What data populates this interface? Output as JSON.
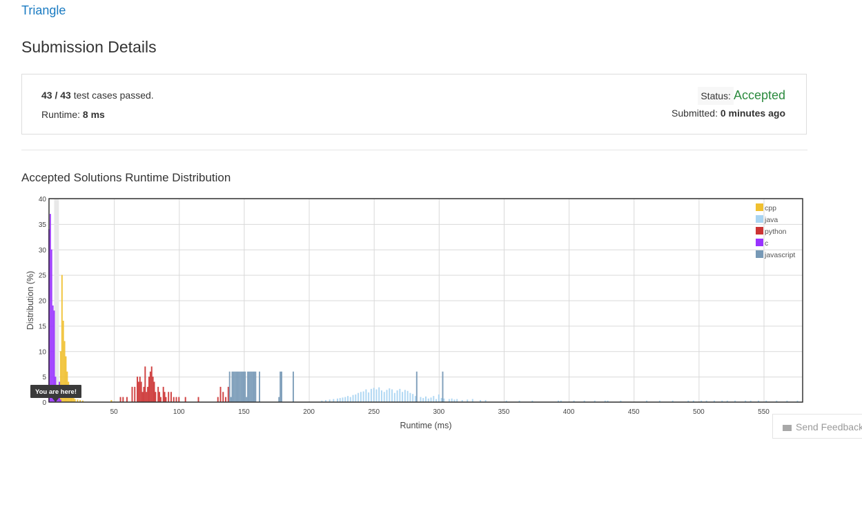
{
  "problem": {
    "title": "Triangle"
  },
  "page": {
    "title": "Submission Details"
  },
  "summary": {
    "passed": "43 / 43",
    "passed_suffix": " test cases passed.",
    "runtime_label": "Runtime: ",
    "runtime_value": "8 ms",
    "status_label": "Status: ",
    "status_value": "Accepted",
    "submitted_label": "Submitted: ",
    "submitted_value": "0 minutes ago"
  },
  "section": {
    "chart_title": "Accepted Solutions Runtime Distribution"
  },
  "feedback": {
    "label": "Send Feedback",
    "icon": "envelope-icon"
  },
  "chart_data": {
    "type": "bar",
    "xlabel": "Runtime (ms)",
    "ylabel": "Distribution (%)",
    "xlim": [
      0,
      580
    ],
    "ylim": [
      0,
      40
    ],
    "xticks": [
      50,
      100,
      150,
      200,
      250,
      300,
      350,
      400,
      450,
      500,
      550
    ],
    "yticks": [
      0,
      5,
      10,
      15,
      20,
      25,
      30,
      35,
      40
    ],
    "grid": true,
    "legend_position": "top-right",
    "marker": {
      "label": "You are here!",
      "x": 5
    },
    "series": [
      {
        "name": "cpp",
        "color": "#f0c030",
        "x": [
          8,
          9,
          10,
          11,
          12,
          13,
          14,
          15,
          16,
          17,
          18,
          19,
          20,
          22,
          24,
          26,
          48
        ],
        "y": [
          3.5,
          10,
          25,
          16,
          12,
          9,
          6,
          4,
          2.5,
          1.5,
          1,
          0.8,
          0.6,
          0.5,
          0.4,
          0.3,
          0.4
        ]
      },
      {
        "name": "java",
        "color": "#a8d4f2",
        "x": [
          210,
          213,
          216,
          219,
          222,
          224,
          226,
          228,
          230,
          232,
          234,
          236,
          238,
          240,
          242,
          244,
          246,
          248,
          250,
          252,
          254,
          256,
          258,
          260,
          262,
          264,
          266,
          268,
          270,
          272,
          274,
          276,
          278,
          280,
          282,
          286,
          288,
          290,
          292,
          294,
          296,
          298,
          300,
          302,
          304,
          308,
          310,
          312,
          314,
          318,
          322,
          326,
          332,
          336,
          352,
          362,
          372,
          392,
          394,
          404,
          412,
          420,
          428,
          430,
          440,
          460,
          470,
          480,
          492,
          496,
          502,
          506,
          512,
          518,
          522,
          528,
          536,
          540,
          546,
          552,
          560,
          568,
          576
        ],
        "y": [
          0.3,
          0.4,
          0.5,
          0.6,
          0.7,
          0.8,
          0.9,
          1.0,
          1.2,
          1.0,
          1.4,
          1.5,
          1.8,
          2.0,
          2.1,
          2.5,
          1.9,
          2.6,
          2.8,
          2.5,
          2.9,
          2.3,
          2.0,
          2.4,
          2.7,
          2.5,
          1.8,
          2.3,
          2.6,
          2.0,
          2.4,
          2.2,
          1.8,
          1.6,
          1.2,
          1.0,
          0.8,
          1.1,
          0.7,
          0.9,
          1.2,
          0.6,
          1.5,
          0.8,
          0.7,
          0.6,
          0.7,
          0.5,
          0.6,
          0.4,
          0.5,
          0.6,
          0.4,
          0.4,
          0.3,
          0.3,
          0.3,
          0.3,
          0.3,
          0.3,
          0.3,
          0.3,
          0.3,
          0.3,
          0.3,
          0.3,
          0.3,
          0.3,
          0.3,
          0.3,
          0.3,
          0.3,
          0.3,
          0.3,
          0.3,
          0.3,
          0.3,
          0.3,
          0.3,
          0.3,
          0.3,
          0.3,
          0.3
        ]
      },
      {
        "name": "python",
        "color": "#cc3333",
        "x": [
          55,
          57,
          60,
          64,
          66,
          68,
          69,
          70,
          71,
          72,
          73,
          74,
          75,
          76,
          77,
          78,
          79,
          80,
          81,
          82,
          84,
          85,
          86,
          88,
          89,
          90,
          92,
          94,
          96,
          98,
          100,
          105,
          115,
          130,
          132,
          134,
          136,
          138
        ],
        "y": [
          1,
          1,
          1,
          3,
          3,
          5,
          4,
          5,
          4,
          2,
          3,
          7,
          2,
          3,
          5,
          6,
          7,
          5,
          4,
          2,
          3,
          2,
          1,
          3,
          2,
          1,
          2,
          2,
          1,
          1,
          1,
          1,
          1,
          1,
          3,
          2,
          1,
          3
        ]
      },
      {
        "name": "c",
        "color": "#9933ff",
        "x": [
          0,
          1,
          2,
          3,
          4,
          5,
          6,
          7,
          8,
          9
        ],
        "y": [
          34,
          37,
          30,
          19,
          18,
          5,
          2,
          1,
          4,
          0.5
        ]
      },
      {
        "name": "javascript",
        "color": "#7799b6",
        "x": [
          139,
          140,
          141,
          142,
          143,
          144,
          145,
          146,
          147,
          148,
          149,
          150,
          151,
          152,
          153,
          154,
          155,
          156,
          157,
          158,
          159,
          162,
          177,
          178,
          179,
          188,
          283,
          303
        ],
        "y": [
          6,
          1,
          6,
          6,
          6,
          6,
          6,
          6,
          6,
          6,
          6,
          6,
          6,
          1,
          6,
          6,
          6,
          6,
          6,
          6,
          6,
          6,
          1,
          6,
          6,
          6,
          6,
          6
        ]
      }
    ]
  }
}
